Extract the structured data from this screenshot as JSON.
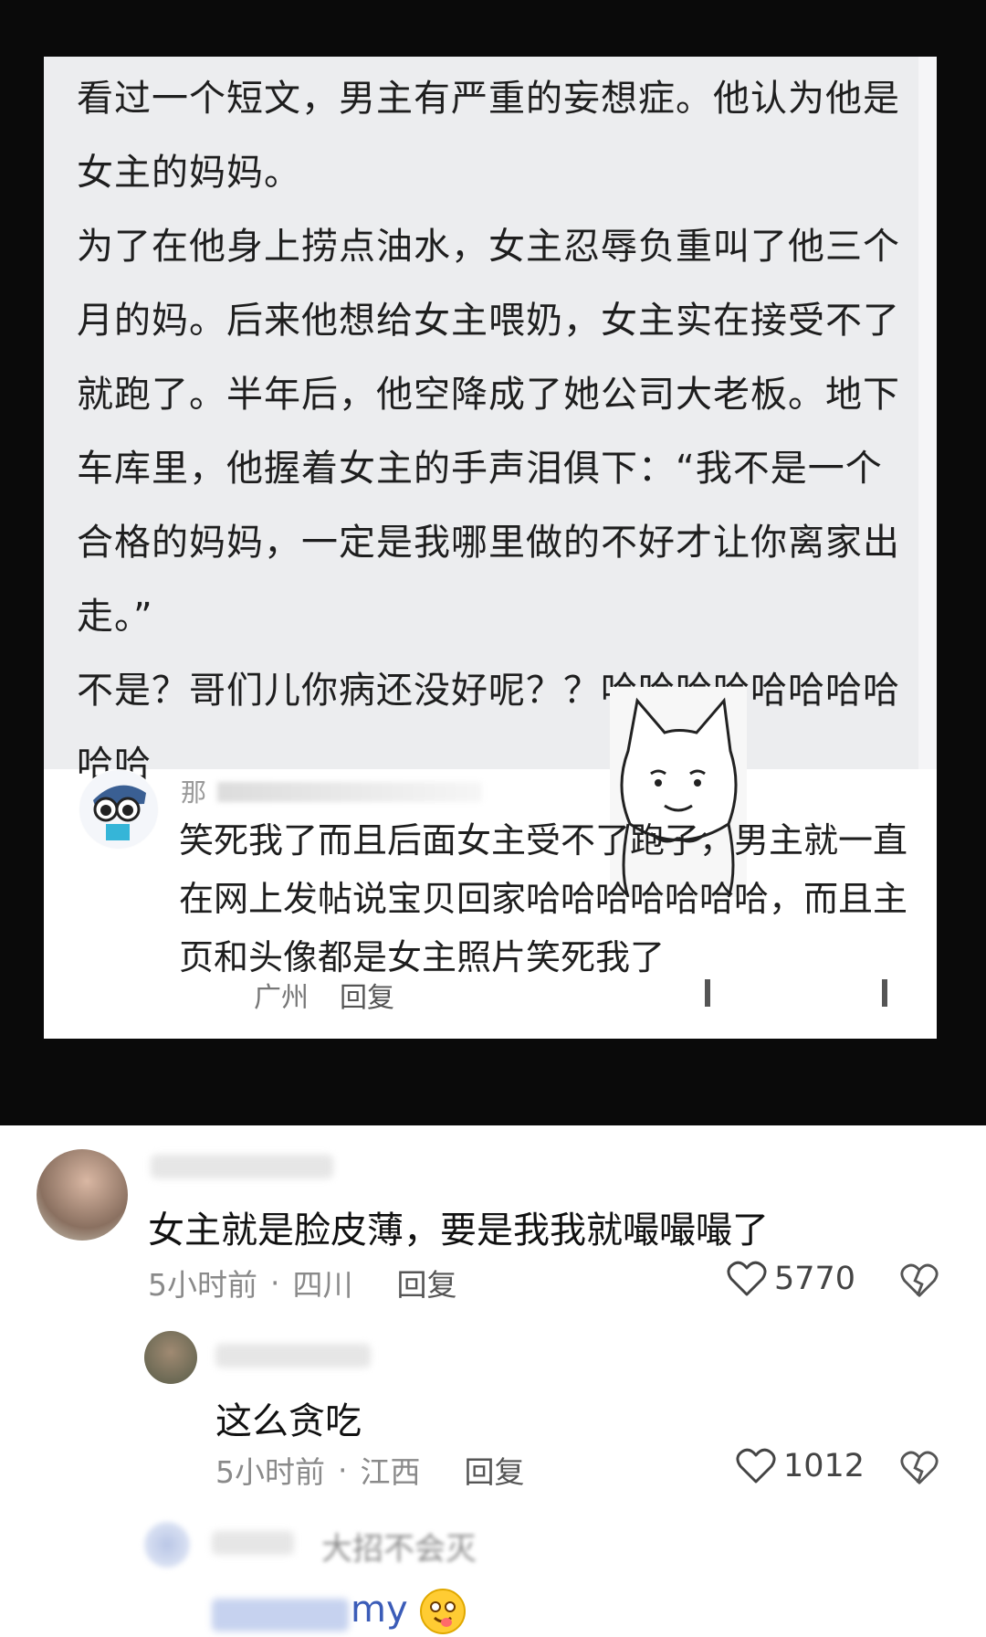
{
  "post": {
    "paragraphs": [
      "看过一个短文，男主有严重的妄想症。他认为他是女主的妈妈。",
      "为了在他身上捞点油水，女主忍辱负重叫了他三个月的妈。后来他想给女主喂奶，女主实在接受不了就跑了。半年后，他空降成了她公司大老板。地下车库里，他握着女主的手声泪俱下：“我不是一个合格的妈妈，一定是我哪里做的不好才让你离家出走。”",
      "不是？哥们儿你病还没好呢？？哈哈哈哈哈哈哈哈哈哈"
    ]
  },
  "embedded_comment": {
    "author": "那",
    "text": "笑死我了而且后面女主受不了跑了，男主就一直在网上发帖说宝贝回家哈哈哈哈哈哈哈，而且主页和头像都是女主照片笑死我了",
    "location": "广州",
    "reply_label": "回复"
  },
  "comments": [
    {
      "text": "女主就是脸皮薄，要是我我就嘬嘬嘬了",
      "time": "5小时前",
      "separator": "·",
      "location": "四川",
      "reply_label": "回复",
      "likes": "5770",
      "like_icon": "heart-outline",
      "dislike_icon": "broken-heart"
    },
    {
      "text": "这么贪吃",
      "time": "5小时前",
      "separator": "·",
      "location": "江西",
      "reply_label": "回复",
      "likes": "1012",
      "like_icon": "heart-outline",
      "dislike_icon": "broken-heart"
    },
    {
      "reply_to": "大招不会灭",
      "text_visible": "my",
      "emoji": "drooling-face"
    }
  ],
  "colors": {
    "top_band": "#0a0a0a",
    "post_background": "#ecedef",
    "text": "#1e1e1e",
    "meta_grey": "#8a8a8a"
  }
}
